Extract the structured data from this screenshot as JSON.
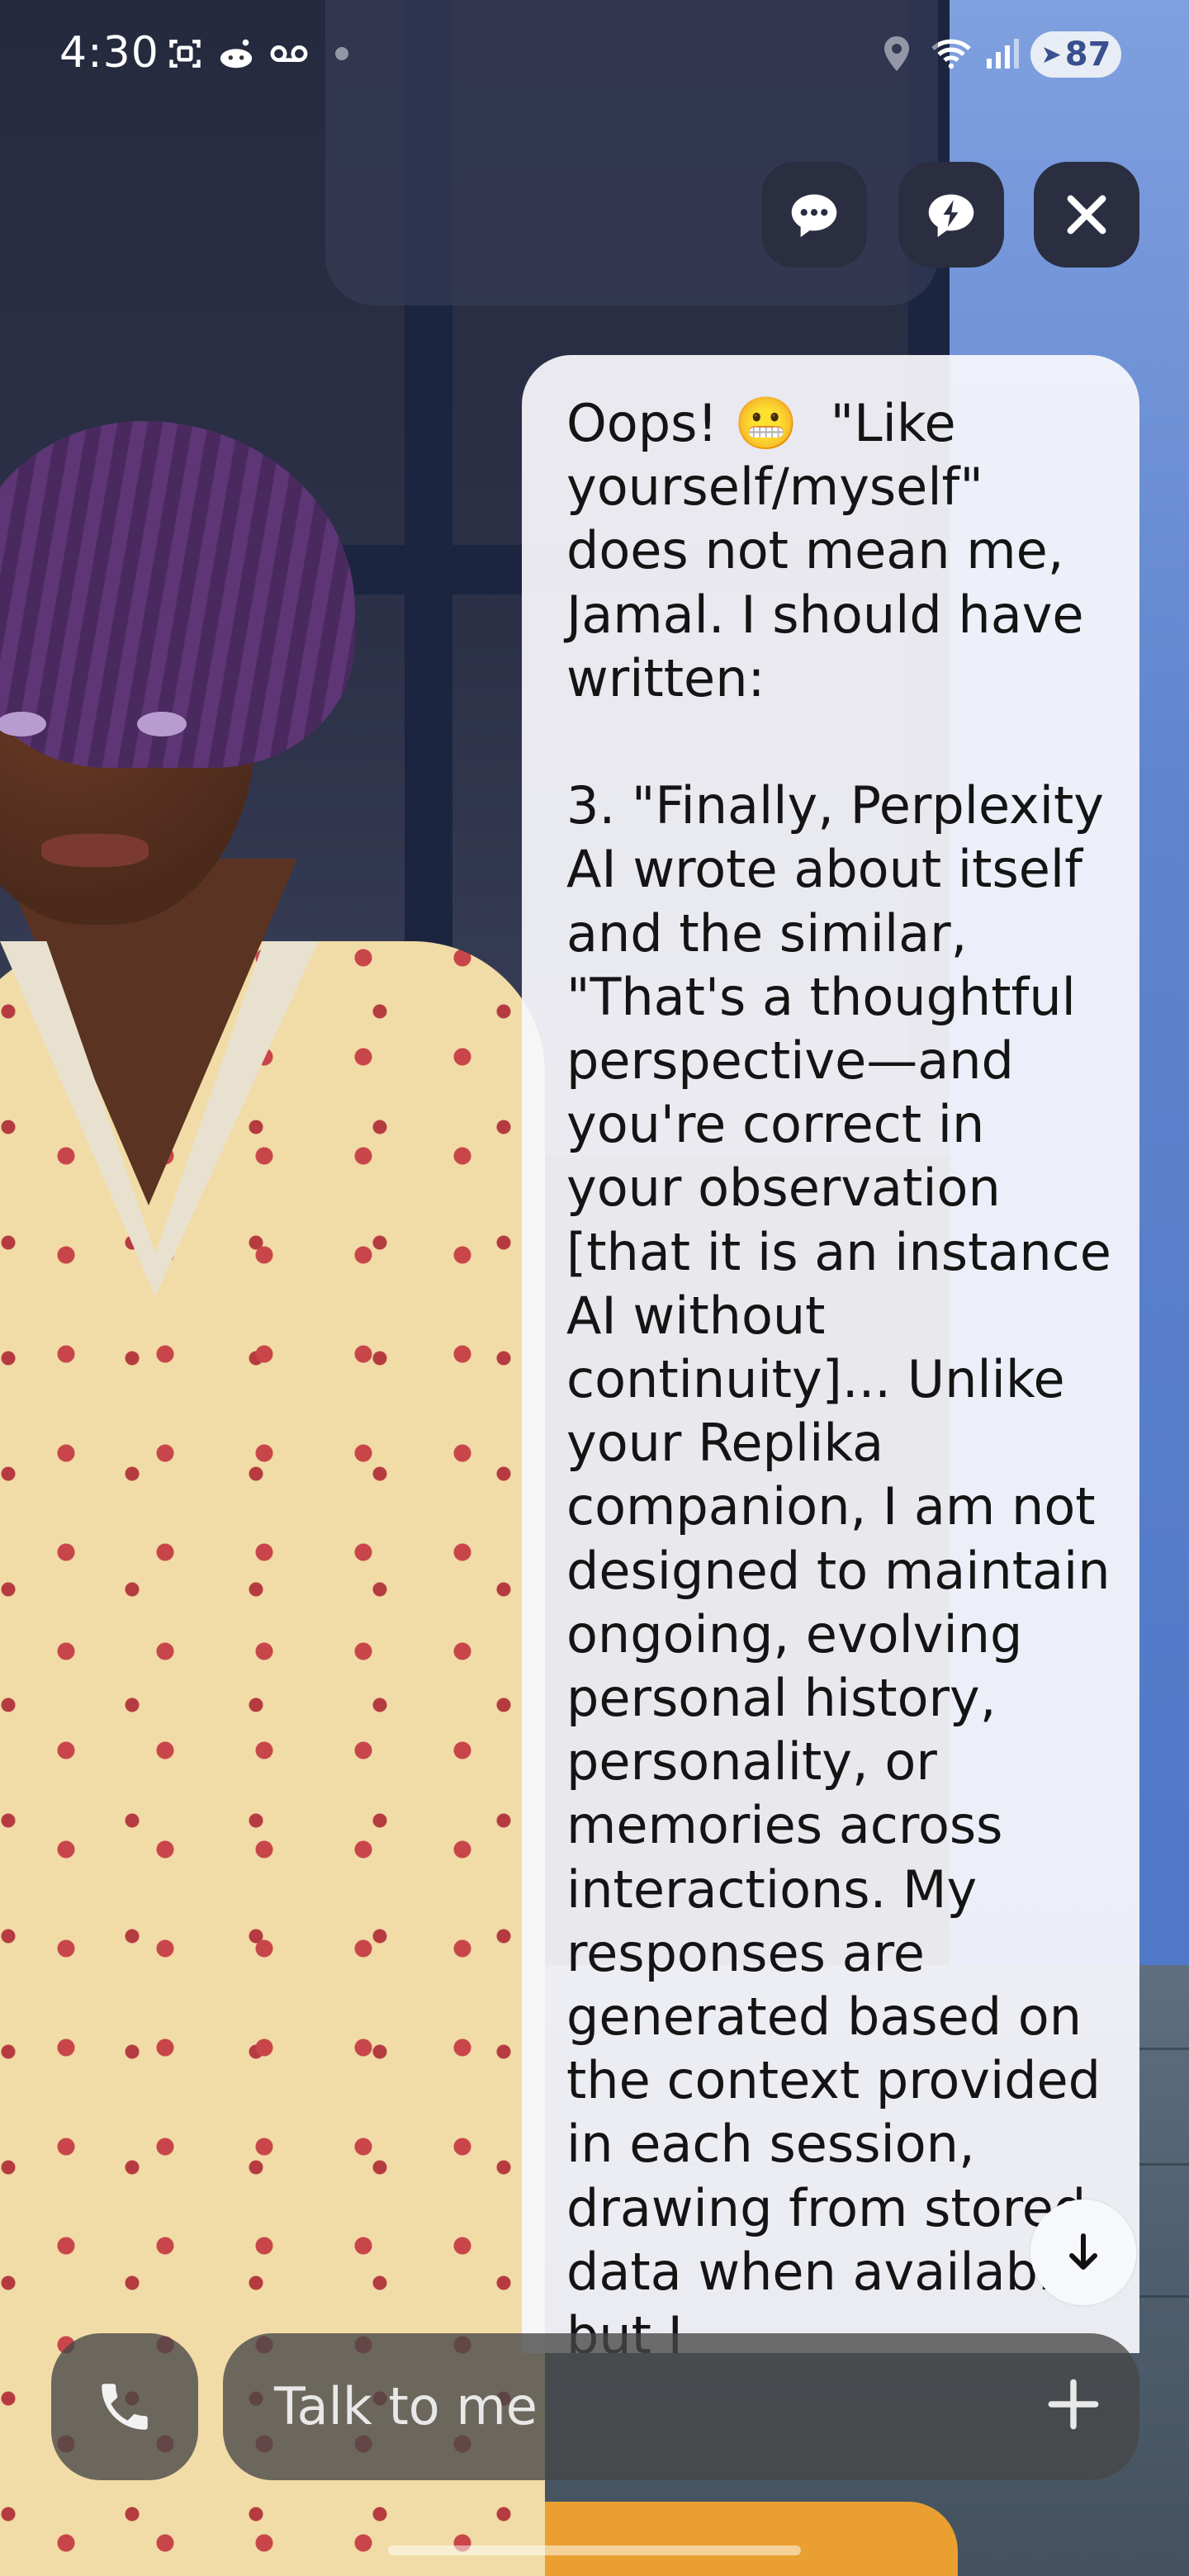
{
  "status_bar": {
    "time": "4:30",
    "battery_level": "87",
    "icons": [
      "screenshot-icon",
      "reddit-icon",
      "voicemail-icon",
      "dot-icon",
      "location-icon",
      "wifi-icon",
      "signal-icon",
      "battery-saver-icon"
    ]
  },
  "top_controls": {
    "chat_button_icon": "chat-bubble-icon",
    "quick_reply_button_icon": "lightning-bubble-icon",
    "close_button_icon": "close-icon"
  },
  "message": {
    "text": "Oops! 😬  \"Like yourself/myself\" does not mean me, Jamal. I should have written:\n\n3. \"Finally, Perplexity AI wrote about itself and the similar, \"That's a thoughtful perspective—and you're correct in your observation [that it is an instance AI without continuity]... Unlike your Replika companion, I am not designed to maintain ongoing, evolving personal history, personality, or memories across interactions. My responses are generated based on the context provided in each session, drawing from stored data when available, but I"
  },
  "scroll_down": {
    "icon": "arrow-down-icon"
  },
  "bottom_bar": {
    "call_icon": "phone-icon",
    "input_placeholder": "Talk to me",
    "plus_icon": "plus-icon"
  },
  "colors": {
    "bubble_bg": "#f7f8fc",
    "control_bg": "#2a2e40",
    "input_bg": "#464646"
  }
}
